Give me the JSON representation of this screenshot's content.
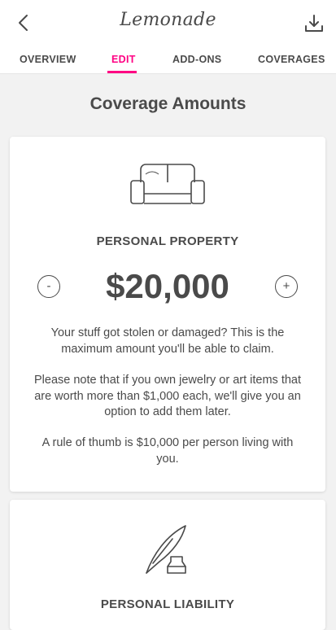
{
  "header": {
    "logo_text": "Lemonade",
    "back_icon": "back-arrow-icon",
    "download_icon": "download-icon"
  },
  "tabs": [
    {
      "label": "OVERVIEW",
      "active": false
    },
    {
      "label": "EDIT",
      "active": true
    },
    {
      "label": "ADD-ONS",
      "active": false
    },
    {
      "label": "COVERAGES",
      "active": false
    }
  ],
  "accent_color": "#ff0083",
  "section_title": "Coverage Amounts",
  "coverages": [
    {
      "icon": "sofa-icon",
      "title": "PERSONAL PROPERTY",
      "amount": "$20,000",
      "decrease_label": "-",
      "increase_label": "+",
      "paragraphs": [
        "Your stuff got stolen or damaged? This is the maximum amount you'll be able to claim.",
        "Please note that if you own jewelry or art items that are worth more than $1,000 each, we'll give you an option to add them later.",
        "A rule of thumb is $10,000 per person living with you."
      ]
    },
    {
      "icon": "quill-ink-icon",
      "title": "PERSONAL LIABILITY"
    }
  ]
}
